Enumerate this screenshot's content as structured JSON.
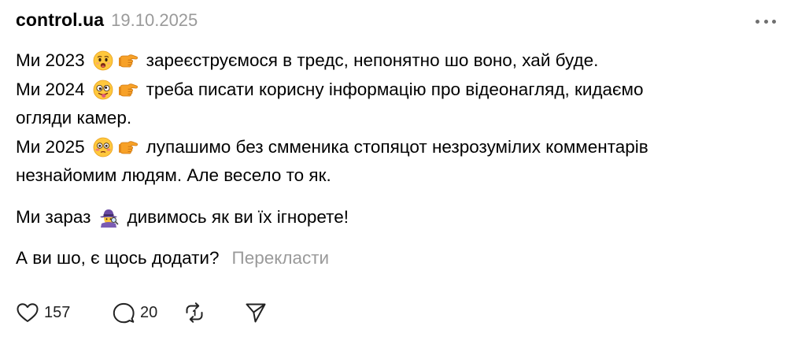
{
  "post": {
    "username": "control.ua",
    "date": "19.10.2025",
    "more_icon": "more-horizontal-icon",
    "lines": {
      "l1_prefix": "Ми 2023",
      "l1_text": "зареєструємося в тредс, непонятно шо воно, хай буде.",
      "l2_prefix": "Ми 2024",
      "l2_text": "треба писати корисну інформацію про відеонагляд, кидаємо",
      "l3_text": "огляди камер.",
      "l4_prefix": "Ми 2025",
      "l4_text": "лупашимо без смменика стопяцот незрозумілих комментарів",
      "l5_text": "незнайомим людям. Але весело то як.",
      "l6_prefix": "Ми зараз",
      "l6_text": "дивимось як ви їх ігнорете!",
      "l7_text": "А ви шо, є щось додати?"
    },
    "translate_label": "Перекласти"
  },
  "actions": {
    "likes": "157",
    "replies": "20"
  }
}
